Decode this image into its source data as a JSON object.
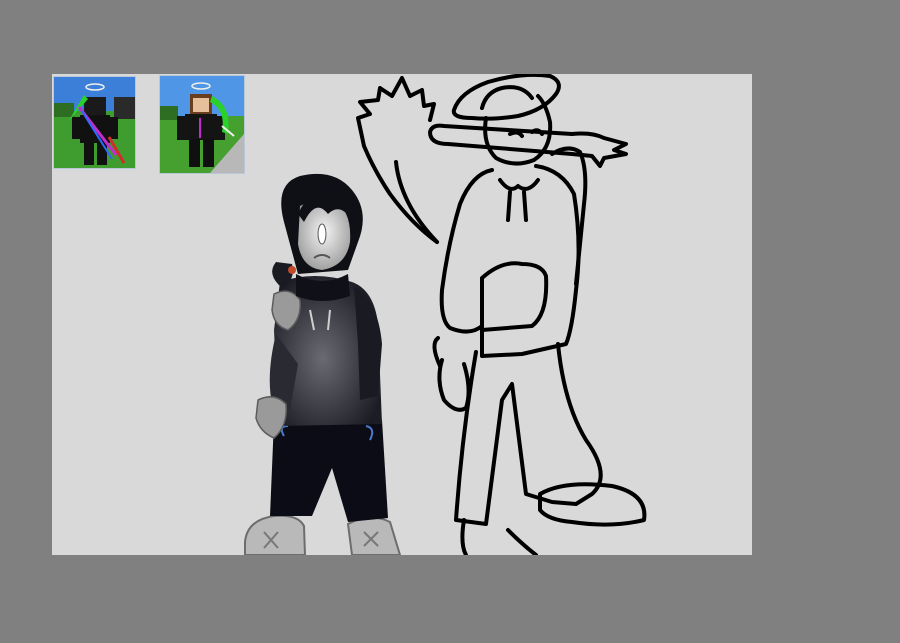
{
  "app": {
    "background_color": "#808080",
    "canvas_color": "#d9d9d9"
  },
  "reference_images": [
    {
      "name": "reference-thumbnail-1",
      "sky": "#3b7fd9",
      "ground": "#3f9c2e"
    },
    {
      "name": "reference-thumbnail-2",
      "sky": "#4f97e6",
      "ground": "#45a02f"
    }
  ],
  "artwork": {
    "shaded_figure": {
      "palette": [
        "#161620",
        "#3a3a44",
        "#8c8c8c",
        "#e8e8e8"
      ]
    },
    "lineart_figure": {
      "stroke": "#000000"
    }
  }
}
